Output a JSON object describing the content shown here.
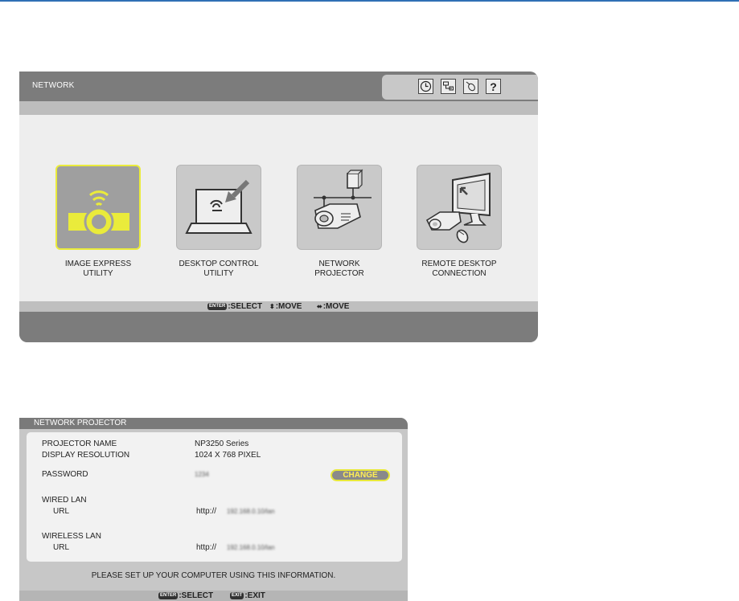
{
  "network_menu": {
    "title": "NETWORK",
    "tray_icons": [
      "timer-icon",
      "network-info-icon",
      "mouse-icon",
      "help-icon"
    ],
    "tray_labels": {
      "help": "?"
    },
    "tiles": [
      {
        "line1": "IMAGE EXPRESS",
        "line2": "UTILITY",
        "icon": "image-express-icon",
        "selected": true
      },
      {
        "line1": "DESKTOP CONTROL",
        "line2": "UTILITY",
        "icon": "desktop-control-icon",
        "selected": false
      },
      {
        "line1": "NETWORK",
        "line2": "PROJECTOR",
        "icon": "network-projector-icon",
        "selected": false
      },
      {
        "line1": "REMOTE DESKTOP",
        "line2": "CONNECTION",
        "icon": "remote-desktop-icon",
        "selected": false
      }
    ],
    "hints": {
      "enter_key": "ENTER",
      "select": ":SELECT",
      "move_vertical": ":MOVE",
      "move_horizontal": ":MOVE"
    }
  },
  "network_projector": {
    "title": "NETWORK PROJECTOR",
    "projector_name_label": "PROJECTOR NAME",
    "projector_name_value": "NP3250 Series",
    "display_resolution_label": "DISPLAY RESOLUTION",
    "display_resolution_value": "1024 X 768 PIXEL",
    "password_label": "PASSWORD",
    "password_value": "1234",
    "change_button": "CHANGE",
    "wired_lan_label": "WIRED LAN",
    "wired_url_label": "URL",
    "wired_url_prefix": "http://",
    "wired_url_value": "192.168.0.10/lan",
    "wireless_lan_label": "WIRELESS LAN",
    "wireless_url_label": "URL",
    "wireless_url_prefix": "http://",
    "wireless_url_value": "192.168.0.10/lan",
    "note": "PLEASE SET UP YOUR COMPUTER USING THIS INFORMATION.",
    "hints": {
      "enter_key": "ENTER",
      "select": ":SELECT",
      "exit_key": "EXIT",
      "exit": ":EXIT"
    }
  },
  "colors": {
    "selection_yellow": "#eaeb3b",
    "panel_dark": "#7c7c7c",
    "panel_light": "#eeeeee",
    "top_rule": "#2f6fb5"
  }
}
